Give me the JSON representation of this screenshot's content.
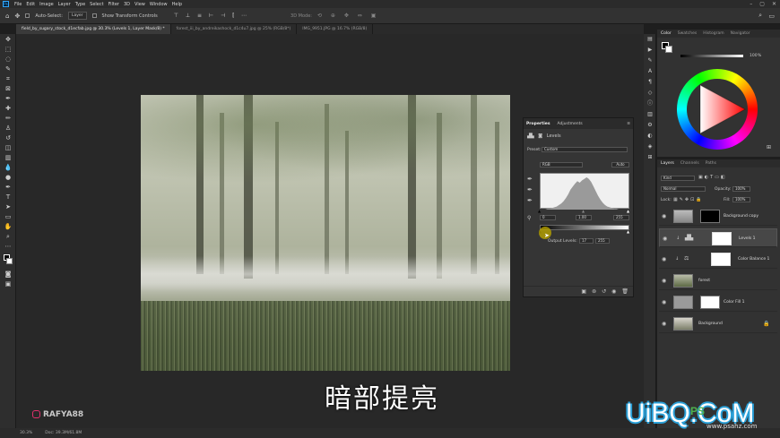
{
  "menubar": {
    "logo": "Ps",
    "items": [
      "File",
      "Edit",
      "Image",
      "Layer",
      "Type",
      "Select",
      "Filter",
      "3D",
      "View",
      "Window",
      "Help"
    ]
  },
  "options": {
    "auto_select_label": "Auto-Select:",
    "auto_select_value": "Layer",
    "transform_label": "Show Transform Controls",
    "mode_3d": "3D Mode:"
  },
  "tabs": [
    "field_by_sugary_stock_d1ecfab.jpg @ 30.3% (Levels 1, Layer Mask/8) *",
    "forest_iii_by_andreikashock_d1c4u7.jpg @ 25% (RGB/8*)",
    "IMG_9951.JPG @ 16.7% (RGB/8)"
  ],
  "properties": {
    "tab_properties": "Properties",
    "tab_adjustments": "Adjustments",
    "adj_name": "Levels",
    "preset_label": "Preset:",
    "preset_value": "Custom",
    "channel": "RGB",
    "auto_label": "Auto",
    "input_black": "0",
    "input_mid": "1.00",
    "input_white": "255",
    "output_label": "Output Levels:",
    "output_black": "17",
    "output_white": "255"
  },
  "colorpanel": {
    "tabs": [
      "Color",
      "Swatches",
      "Histogram",
      "Navigator"
    ],
    "brightness_value": "100",
    "brightness_unit": "%"
  },
  "layers": {
    "tabs": [
      "Layers",
      "Channels",
      "Paths"
    ],
    "filter_label": "Kind",
    "blend_mode": "Normal",
    "opacity_label": "Opacity:",
    "opacity_value": "100%",
    "lock_label": "Lock:",
    "fill_label": "Fill:",
    "fill_value": "100%",
    "items": [
      {
        "name": "Background copy"
      },
      {
        "name": "Levels 1"
      },
      {
        "name": "Color Balance 1"
      },
      {
        "name": "forest"
      },
      {
        "name": "Color Fill 1"
      },
      {
        "name": "Background"
      }
    ]
  },
  "status": {
    "zoom": "30.3%",
    "doc": "Doc: 39.3M/61.8M"
  },
  "overlay": {
    "subtitle": "暗部提亮",
    "instagram": "RAFYA88",
    "watermark": "UiBQ.CoM",
    "watermark_badge": "PS",
    "watermark_site": "www.psahz.com"
  },
  "colors": {
    "accent": "#31a8ff",
    "selected_layer": "#474747",
    "output_slider_marker": "#b8a400"
  },
  "histogram_shape": [
    0,
    0,
    0,
    1,
    1,
    2,
    3,
    4,
    6,
    8,
    11,
    15,
    20,
    26,
    30,
    34,
    37,
    35,
    38,
    40,
    42,
    40,
    36,
    30,
    24,
    18,
    13,
    9,
    6,
    4,
    3,
    2,
    1,
    1,
    0,
    0,
    0,
    0,
    0,
    0
  ]
}
